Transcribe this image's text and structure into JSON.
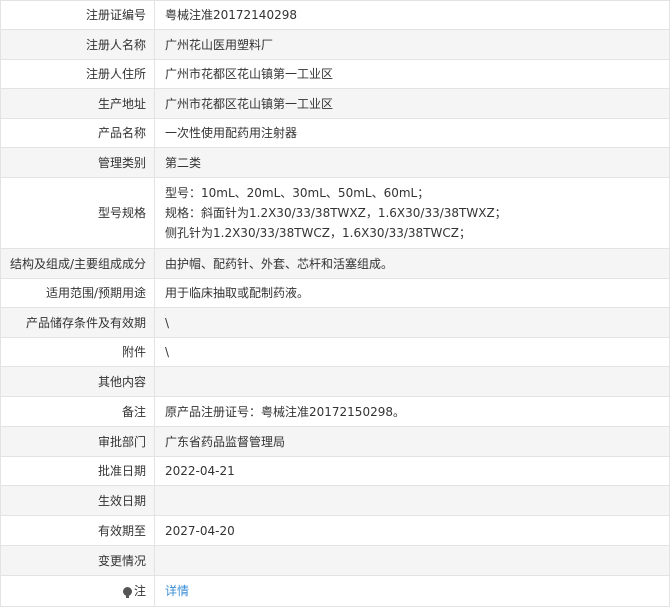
{
  "rows": [
    {
      "label": "注册证编号",
      "value": "粤械注准20172140298"
    },
    {
      "label": "注册人名称",
      "value": "广州花山医用塑料厂"
    },
    {
      "label": "注册人住所",
      "value": "广州市花都区花山镇第一工业区"
    },
    {
      "label": "生产地址",
      "value": "广州市花都区花山镇第一工业区"
    },
    {
      "label": "产品名称",
      "value": "一次性使用配药用注射器"
    },
    {
      "label": "管理类别",
      "value": "第二类"
    },
    {
      "label": "型号规格",
      "lines": [
        "型号：10mL、20mL、30mL、50mL、60mL；",
        "规格：斜面针为1.2X30/33/38TWXZ，1.6X30/33/38TWXZ；",
        "侧孔针为1.2X30/33/38TWCZ，1.6X30/33/38TWCZ；"
      ]
    },
    {
      "label": "结构及组成/主要组成成分",
      "value": "由护帽、配药针、外套、芯杆和活塞组成。"
    },
    {
      "label": "适用范围/预期用途",
      "value": "用于临床抽取或配制药液。"
    },
    {
      "label": "产品储存条件及有效期",
      "value": "\\"
    },
    {
      "label": "附件",
      "value": "\\"
    },
    {
      "label": "其他内容",
      "value": ""
    },
    {
      "label": "备注",
      "value": "原产品注册证号：粤械注准20172150298。"
    },
    {
      "label": "审批部门",
      "value": "广东省药品监督管理局"
    },
    {
      "label": "批准日期",
      "value": "2022-04-21"
    },
    {
      "label": "生效日期",
      "value": ""
    },
    {
      "label": "有效期至",
      "value": "2027-04-20"
    },
    {
      "label": "变更情况",
      "value": ""
    },
    {
      "label": "注",
      "value": "详情",
      "icon": "lightbulb-icon"
    }
  ],
  "colors": {
    "border": "#e3e3e3",
    "alt_row": "#f5f5f5",
    "link": "#3a8ed6"
  }
}
